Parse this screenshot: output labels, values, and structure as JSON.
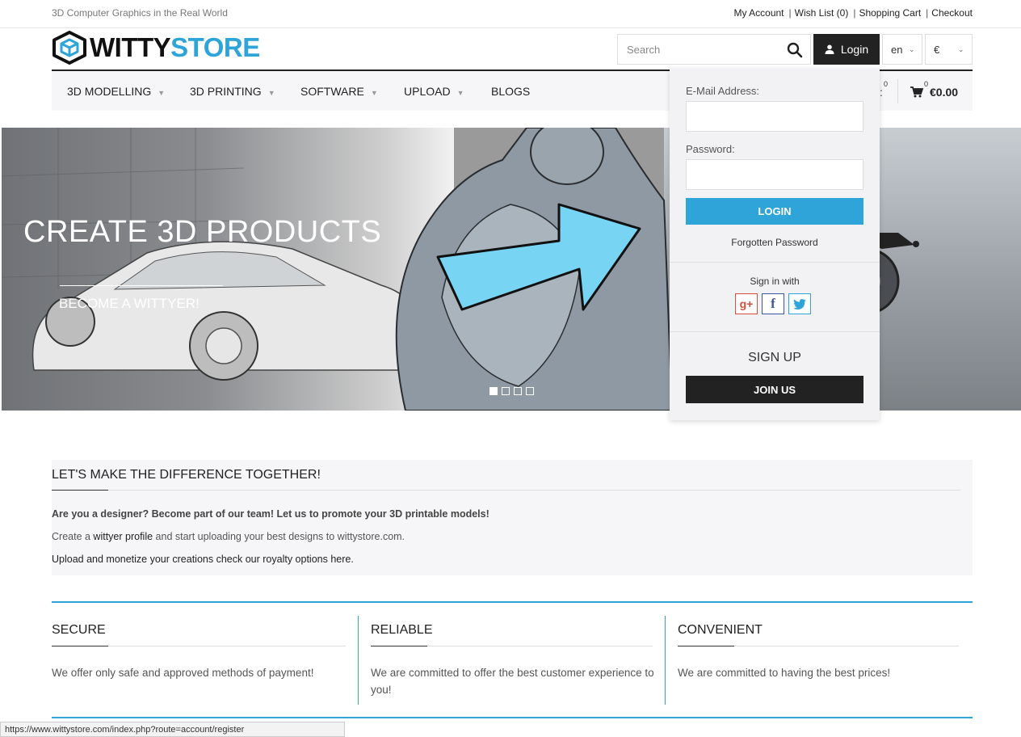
{
  "topbar": {
    "tagline": "3D Computer Graphics in the Real World",
    "links": {
      "my_account": "My Account",
      "wish_list": "Wish List (0)",
      "shopping_cart": "Shopping Cart",
      "checkout": "Checkout"
    }
  },
  "logo": {
    "part1": "WITTY",
    "part2": "STORE"
  },
  "search": {
    "placeholder": "Search"
  },
  "header": {
    "login_label": "Login",
    "language": "en",
    "currency": "€"
  },
  "nav": {
    "items": [
      {
        "label": "3D MODELLING"
      },
      {
        "label": "3D PRINTING"
      },
      {
        "label": "SOFTWARE"
      },
      {
        "label": "UPLOAD"
      },
      {
        "label": "BLOGS"
      }
    ],
    "wish_count": "0",
    "cart_count": "0",
    "cart_total": "€0.00"
  },
  "hero": {
    "title": "CREATE 3D PRODUCTS",
    "cta": "BECOME A WITTYER!",
    "slide_count": 4,
    "active_slide": 1
  },
  "login_dropdown": {
    "email_label": "E-Mail Address:",
    "password_label": "Password:",
    "login_button": "LOGIN",
    "forgotten": "Forgotten Password",
    "sign_in_with": "Sign in with",
    "social": {
      "google": "g+",
      "facebook": "f"
    },
    "sign_up": "SIGN UP",
    "join_button": "JOIN US"
  },
  "info": {
    "title": "LET'S MAKE THE DIFFERENCE TOGETHER!",
    "p1": "Are you a designer? Become part of our team! Let us to promote your 3D printable models!",
    "p2_a": "Create a ",
    "p2_link": "wittyer profile",
    "p2_b": " and start uploading your best designs to wittystore.com.",
    "p3_link": "Upload and monetize your creations check our royalty options here",
    "p3_end": "."
  },
  "features": [
    {
      "title": "SECURE",
      "text": "We offer only safe and approved methods of payment!"
    },
    {
      "title": "RELIABLE",
      "text": "We are committed to offer the best customer experience to you!"
    },
    {
      "title": "CONVENIENT",
      "text": "We are committed to having the best prices!"
    }
  ],
  "statusbar": {
    "url": "https://www.wittystore.com/index.php?route=account/register"
  },
  "colors": {
    "accent": "#2fa4d8",
    "dark": "#222222",
    "panel": "#f6f6f8"
  }
}
